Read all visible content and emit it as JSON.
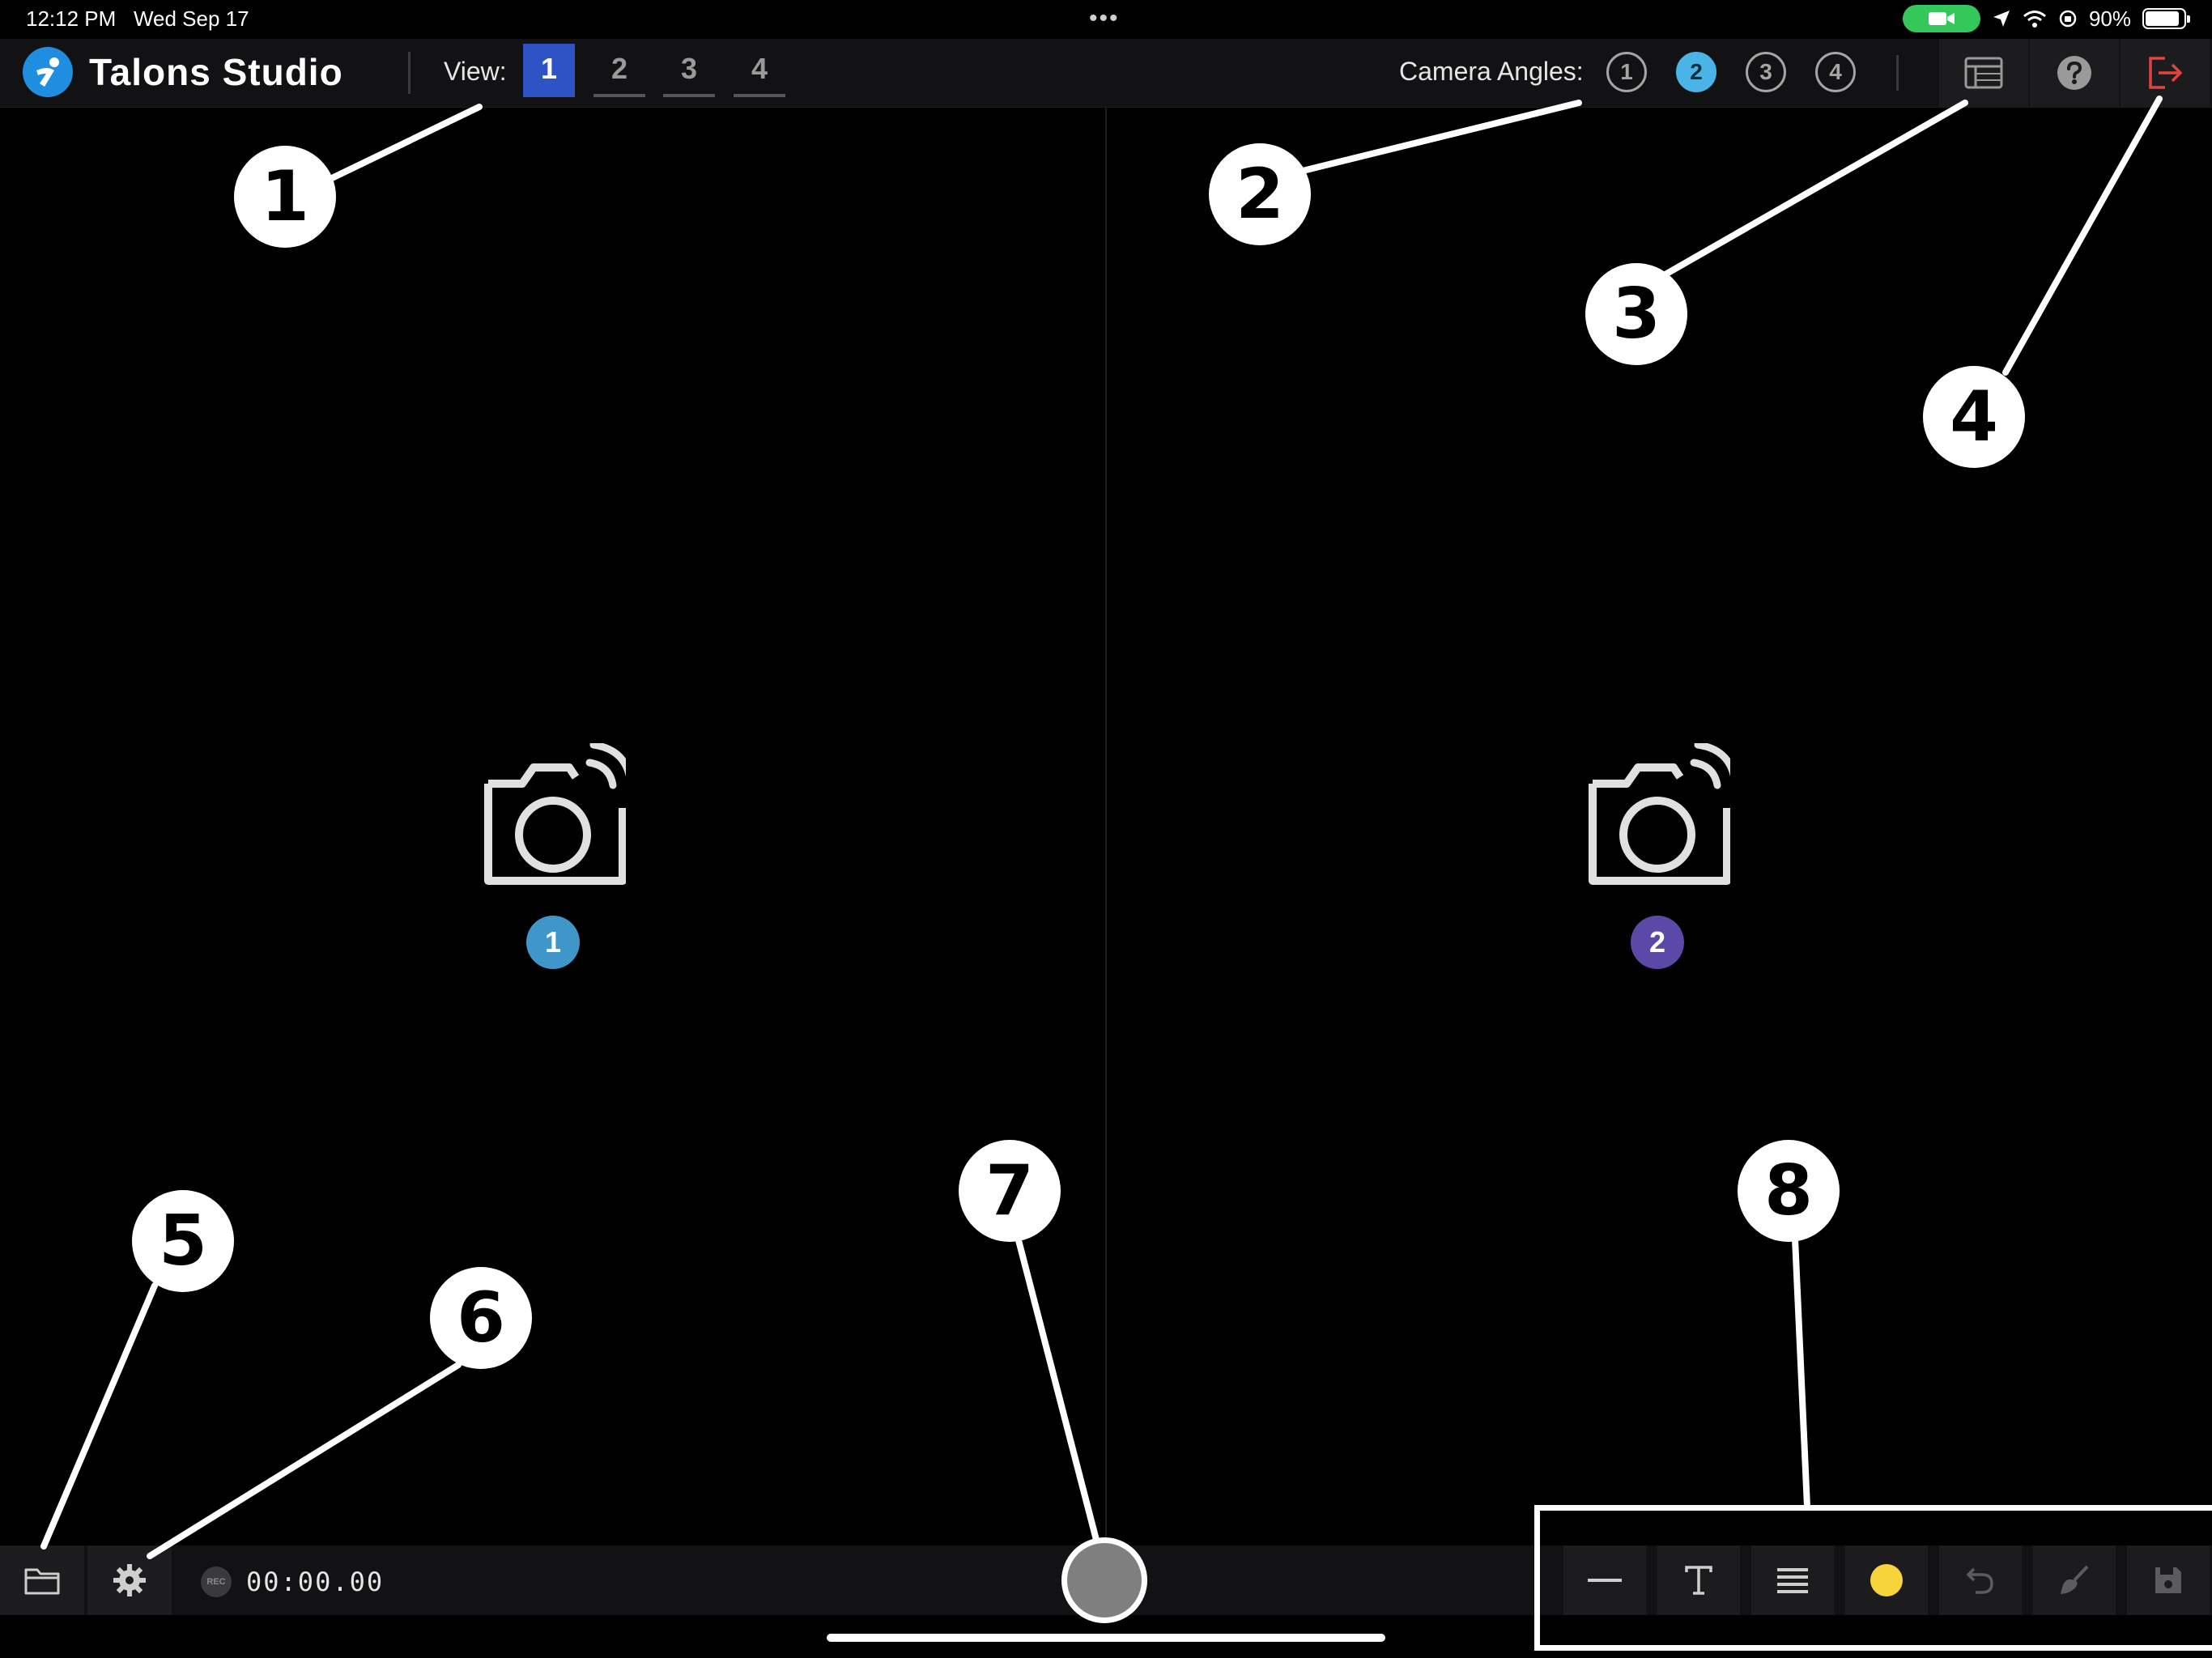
{
  "status": {
    "time": "12:12 PM",
    "date": "Wed Sep 17",
    "dots": "•••",
    "battery": "90%",
    "battery_level": 0.9
  },
  "app": {
    "name": "Talons Studio",
    "brand_color": "#1f8ee0"
  },
  "view": {
    "label": "View:",
    "tabs": [
      "1",
      "2",
      "3",
      "4"
    ],
    "active": 1,
    "active_color": "#2f52c4"
  },
  "camera_angles": {
    "label": "Camera Angles:",
    "items": [
      "1",
      "2",
      "3",
      "4"
    ],
    "active": 2,
    "active_color": "#4bb4e6"
  },
  "toolbar_right": {
    "icons": [
      "list-panel-icon",
      "help-icon",
      "logout-icon"
    ],
    "logout_color": "#e0443e"
  },
  "panes": [
    {
      "camera": "1",
      "badge_color": "#3f97c9"
    },
    {
      "camera": "2",
      "badge_color": "#5a49a6"
    }
  ],
  "bottom": {
    "rec_badge": "REC",
    "timer": "00:00.00",
    "icons": [
      "folder-icon",
      "gear-icon"
    ],
    "draw_tools": [
      "line-tool-icon",
      "text-tool-icon",
      "line-weight-icon",
      "color-picker",
      "undo-icon",
      "clear-brush-icon",
      "save-icon"
    ],
    "draw_color": "#f7d43b"
  },
  "callouts": [
    "1",
    "2",
    "3",
    "4",
    "5",
    "6",
    "7",
    "8"
  ]
}
